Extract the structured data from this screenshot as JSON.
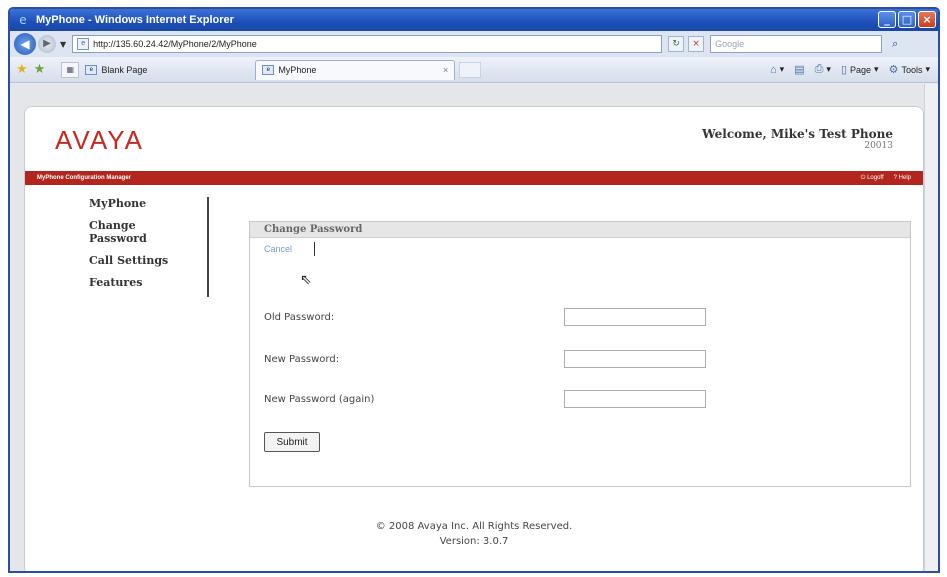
{
  "window": {
    "title": "MyPhone - Windows Internet Explorer",
    "controls": [
      "minimize",
      "maximize",
      "close"
    ]
  },
  "address_bar": {
    "url": "http://135.60.24.42/MyPhone/2/MyPhone",
    "search_placeholder": "Google"
  },
  "tabs": [
    {
      "label": "Blank Page",
      "icon": "page-icon"
    },
    {
      "label": "MyPhone",
      "icon": "page-icon",
      "active": true
    }
  ],
  "command_bar": {
    "page_label": "Page",
    "tools_label": "Tools"
  },
  "app": {
    "logo": "AVAYA",
    "welcome": "Welcome, Mike's Test Phone",
    "extension": "20013",
    "app_name": "MyPhone Configuration Manager",
    "logoff": "Logoff",
    "help": "Help",
    "brand_color": "#b3261e"
  },
  "sidebar": {
    "items": [
      {
        "label": "MyPhone"
      },
      {
        "label": "Change Password"
      },
      {
        "label": "Call Settings"
      },
      {
        "label": "Features"
      }
    ]
  },
  "form": {
    "title": "Change Password",
    "cancel": "Cancel",
    "fields": [
      {
        "label": "Old Password:",
        "value": ""
      },
      {
        "label": "New Password:",
        "value": ""
      },
      {
        "label": "New Password (again)",
        "value": ""
      }
    ],
    "submit": "Submit"
  },
  "footer": {
    "copyright": "© 2008 Avaya Inc. All Rights Reserved.",
    "version": "Version: 3.0.7"
  }
}
